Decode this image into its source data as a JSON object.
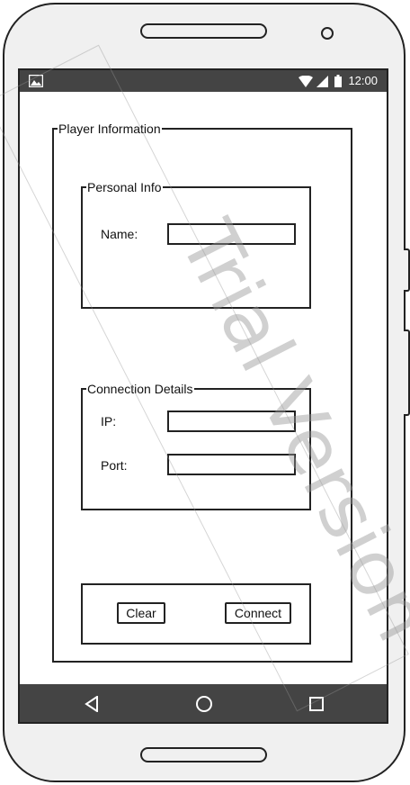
{
  "status_bar": {
    "time": "12:00"
  },
  "player_info": {
    "legend": "Player Information",
    "personal": {
      "legend": "Personal Info",
      "name_label": "Name:",
      "name_value": ""
    },
    "connection": {
      "legend": "Connection Details",
      "ip_label": "IP:",
      "ip_value": "",
      "port_label": "Port:",
      "port_value": ""
    },
    "actions": {
      "clear_label": "Clear",
      "connect_label": "Connect"
    }
  },
  "watermark": "Trial Version",
  "colors": {
    "bars": "#444444",
    "outline": "#222222",
    "body": "#f0f0f0"
  }
}
